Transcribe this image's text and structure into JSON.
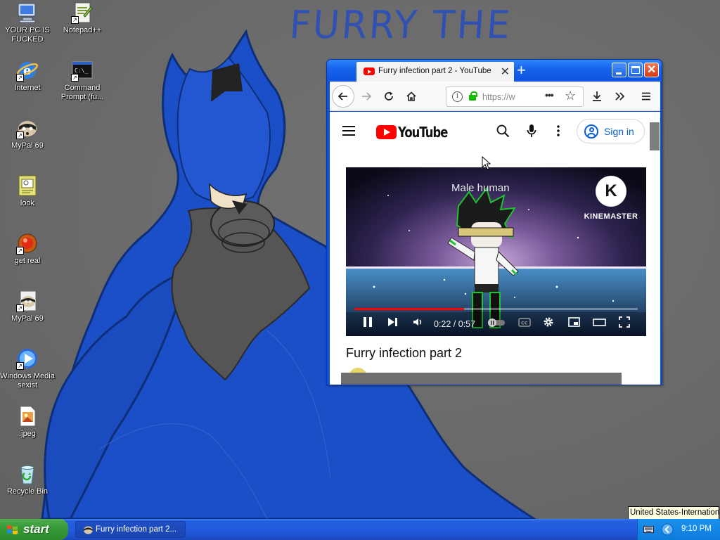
{
  "desktop": {
    "wallpaper_text": "FURRY THE",
    "icons": [
      {
        "label": "YOUR PC IS FUCKED",
        "icon": "my-computer-icon"
      },
      {
        "label": "Notepad++",
        "icon": "notepadpp-icon"
      },
      {
        "label": "Internet",
        "icon": "internet-explorer-icon"
      },
      {
        "label": "Command Prompt (fu...",
        "icon": "command-prompt-icon"
      },
      {
        "label": "MyPal 69",
        "icon": "mypal-icon"
      },
      {
        "label": "look",
        "icon": "document-icon"
      },
      {
        "label": "get real",
        "icon": "red-orb-icon"
      },
      {
        "label": "MyPal 69",
        "icon": "mypal-icon"
      },
      {
        "label": "Windows Media sexist",
        "icon": "windows-media-player-icon"
      },
      {
        "label": ".jpeg",
        "icon": "image-file-icon"
      },
      {
        "label": "Recycle Bin",
        "icon": "recycle-bin-icon"
      }
    ]
  },
  "browser": {
    "tab_title": "Furry infection part 2 - YouTube",
    "new_tab_glyph": "+",
    "url": "https://w",
    "page": {
      "logo_text": "YouTube",
      "signin_label": "Sign in",
      "video": {
        "overlay_text": "Male human",
        "watermark": "KINEMASTER",
        "watermark_letter": "K",
        "current_time": "0:22",
        "duration": "0:57",
        "time_display": "0:22 / 0:57",
        "progress_fraction": 0.386
      },
      "video_title": "Furry infection part 2"
    }
  },
  "taskbar": {
    "start_label": "start",
    "task_label": "Furry infection part 2...",
    "clock": "9:10 PM",
    "tooltip": "United States-International"
  },
  "colors": {
    "wallpaper_bg": "#6a6a6a",
    "wallpaper_blue": "#2c4fb8",
    "xp_blue": "#245be0",
    "start_green": "#379b37",
    "yt_red": "#ff0000",
    "signin_blue": "#065fd4"
  }
}
